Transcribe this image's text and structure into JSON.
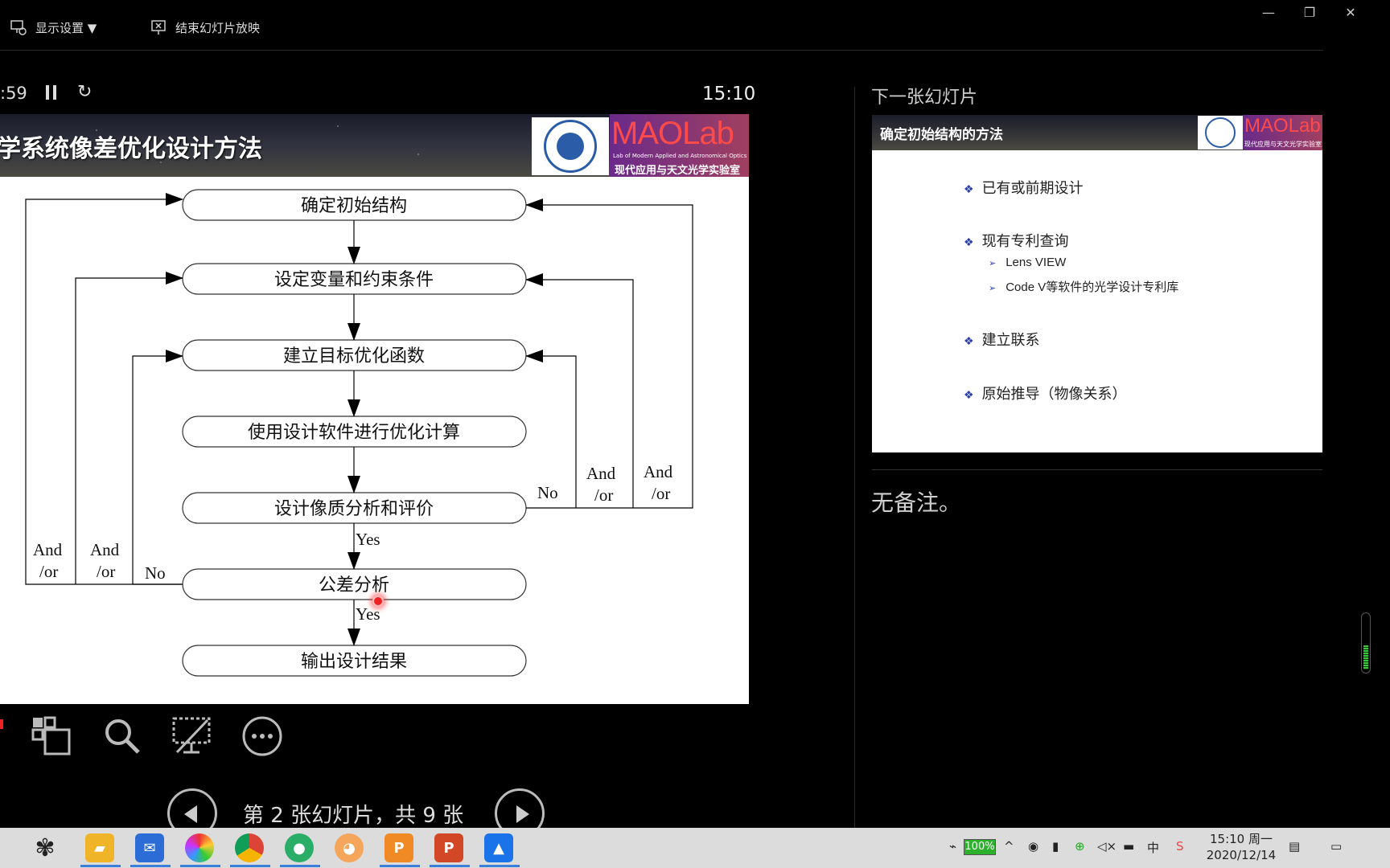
{
  "topbar": {
    "display_settings": "显示设置 ▼",
    "end_show": "结束幻灯片放映",
    "minimize": "—",
    "restore": "❐",
    "close": "✕"
  },
  "presenter": {
    "elapsed": ":59",
    "clock": "15:10",
    "slide_counter": "第 2 张幻灯片，共 9 张",
    "next_label": "下一张幻灯片",
    "notes": "无备注。"
  },
  "current_slide": {
    "title": "学系统像差优化设计方法",
    "logo_text": "MAOLab",
    "logo_en": "Lab of Modern Applied and Astronomical Optics",
    "logo_cn": "现代应用与天文光学实验室",
    "flow_nodes": [
      "确定初始结构",
      "设定变量和约束条件",
      "建立目标优化函数",
      "使用设计软件进行优化计算",
      "设计像质分析和评价",
      "公差分析",
      "输出设计结果"
    ],
    "labels": {
      "yes1": "Yes",
      "yes2": "Yes",
      "no_right": "No",
      "no_left": "No",
      "and": "And",
      "or": "/or"
    }
  },
  "next_slide": {
    "title": "确定初始结构的方法",
    "logo_text": "MAOLab",
    "logo_cn": "现代应用与天文光学实验室",
    "bullets": [
      "已有或前期设计",
      "现有专利查询",
      "建立联系",
      "原始推导（物像关系）"
    ],
    "sub_bullets": [
      "Lens VIEW",
      "Code V等软件的光学设计专利库"
    ]
  },
  "taskbar": {
    "battery": "100%",
    "ime": "中",
    "time": "15:10 周一",
    "date": "2020/12/14"
  }
}
